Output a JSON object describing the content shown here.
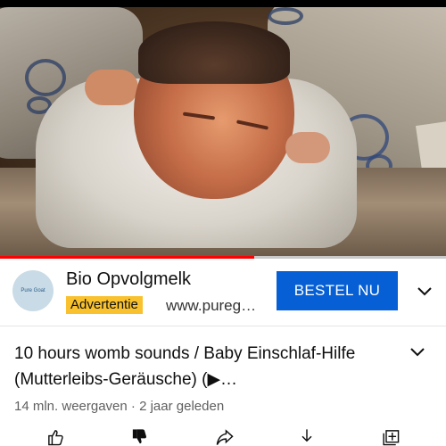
{
  "video": {
    "progress_fraction": 0.57
  },
  "ad": {
    "advertiser": "Bio Opvolgmelk",
    "logo_text": "Pure Goat",
    "badge": "Advertentie",
    "url": "www.pureg…",
    "cta": "BESTEL NU"
  },
  "video_info": {
    "title": "10 hours womb sounds / Baby Einschlaf-Hilfe (Mutterleibs-Geräusche) (▶…",
    "views": "14 mln. weergaven",
    "separator": "·",
    "age": "2 jaar geleden"
  },
  "colors": {
    "cta": "#065fd4",
    "badge": "#f9c12e",
    "progress": "#ff0000"
  },
  "icons": [
    "chevron-down-icon",
    "like-icon",
    "dislike-icon",
    "share-icon",
    "download-icon",
    "save-icon"
  ]
}
